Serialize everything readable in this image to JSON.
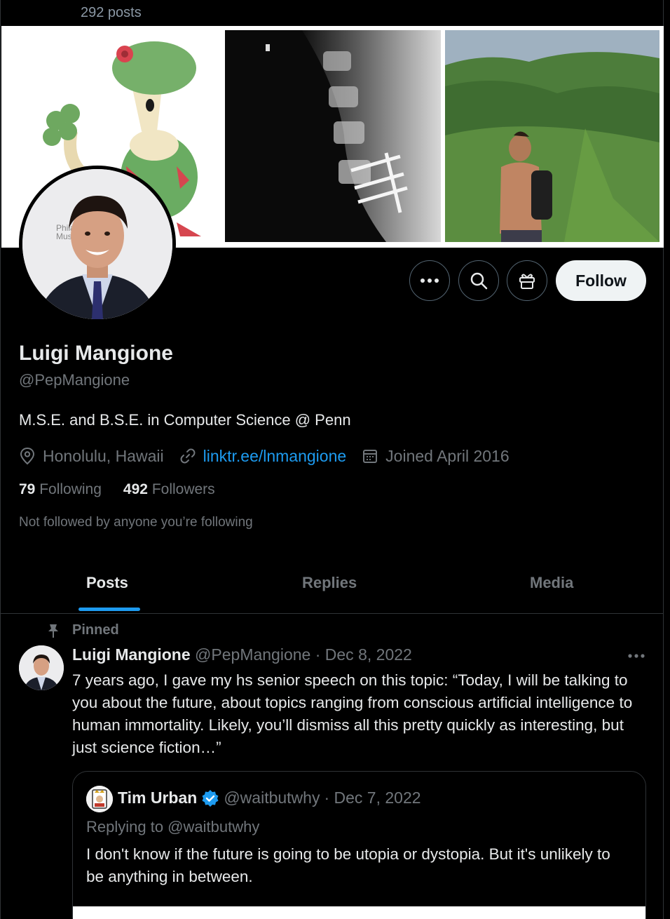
{
  "header": {
    "post_count": "292 posts",
    "back_icon": "arrow-left-icon"
  },
  "banner": {
    "images": [
      "pokemon-illustration",
      "spine-xray",
      "mountain-hike-photo"
    ],
    "avatar_backdrop_text": [
      "Philad",
      "Muse"
    ]
  },
  "actions": {
    "more_icon": "ellipsis-icon",
    "search_icon": "search-icon",
    "gift_icon": "gift-icon",
    "follow_label": "Follow"
  },
  "profile": {
    "name": "Luigi Mangione",
    "handle": "@PepMangione",
    "bio": "M.S.E. and B.S.E. in Computer Science @ Penn",
    "location": "Honolulu, Hawaii",
    "link": "linktr.ee/lnmangione",
    "joined": "Joined April 2016",
    "following_count": "79",
    "following_label": "Following",
    "followers_count": "492",
    "followers_label": "Followers",
    "not_followed_text": "Not followed by anyone you’re following"
  },
  "tabs": [
    {
      "label": "Posts",
      "active": true
    },
    {
      "label": "Replies",
      "active": false
    },
    {
      "label": "Media",
      "active": false
    }
  ],
  "tweet": {
    "pinned_label": "Pinned",
    "name": "Luigi Mangione",
    "handle": "@PepMangione",
    "date": "· Dec 8, 2022",
    "text": "7 years ago, I gave my hs senior speech on this topic: “Today, I will be talking to you about the future, about topics ranging from conscious artificial intelligence to human immortality. Likely, you’ll dismiss all this pretty quickly as interesting, but just science fiction…”",
    "quote": {
      "name": "Tim Urban",
      "handle": "@waitbutwhy",
      "date": "· Dec 7, 2022",
      "replying_to": "Replying to @waitbutwhy",
      "text": "I don't know if the future is going to be utopia or dystopia. But it's unlikely to be anything in between."
    }
  },
  "colors": {
    "background": "#000000",
    "text_primary": "#e7e9ea",
    "text_secondary": "#71767b",
    "accent": "#1d9bf0",
    "border": "#2f3336"
  }
}
